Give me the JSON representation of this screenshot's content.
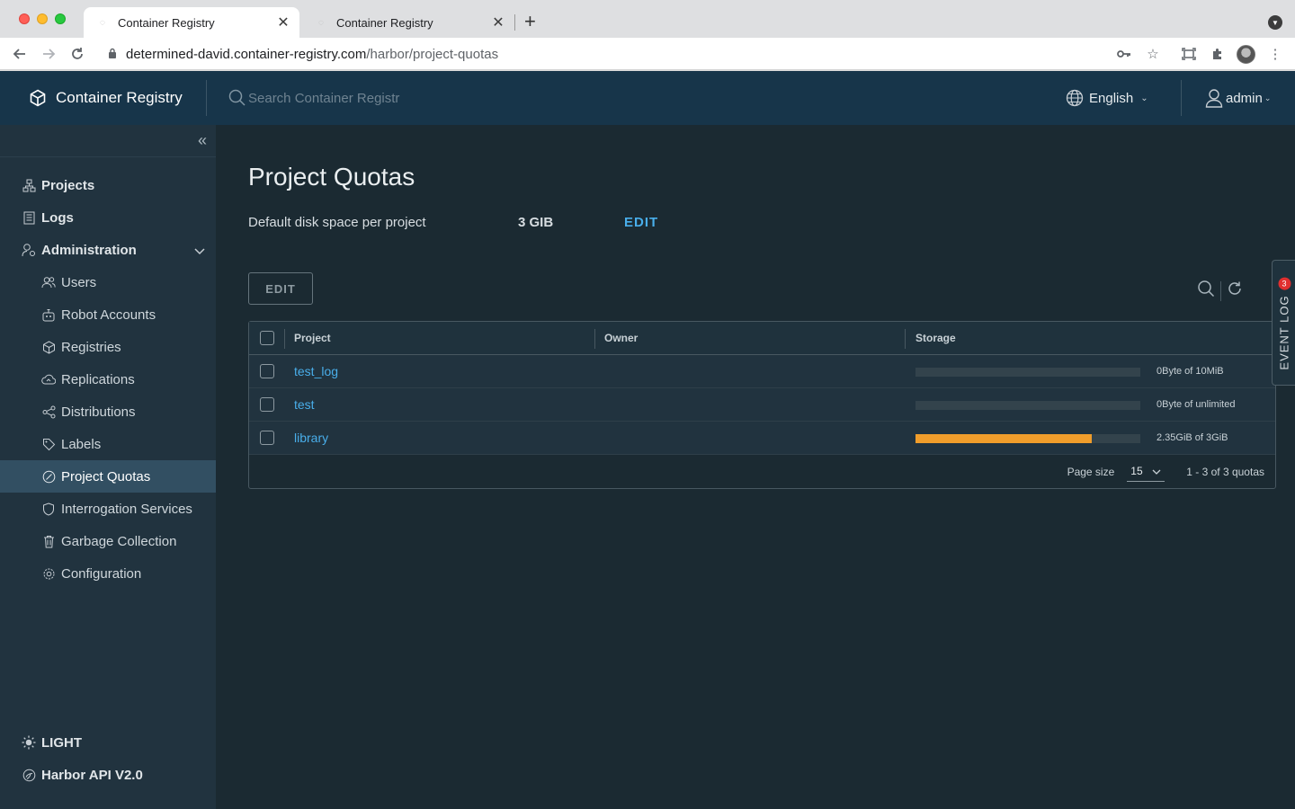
{
  "browser": {
    "tabs": [
      {
        "title": "Container Registry",
        "active": true
      },
      {
        "title": "Container Registry",
        "active": false
      }
    ],
    "url_host": "determined-david.container-registry.com",
    "url_path": "/harbor/project-quotas"
  },
  "header": {
    "brand": "Container Registry",
    "search_placeholder": "Search Container Registr",
    "language": "English",
    "user": "admin"
  },
  "sidebar": {
    "items": [
      {
        "label": "Projects"
      },
      {
        "label": "Logs"
      },
      {
        "label": "Administration"
      }
    ],
    "admin_items": [
      {
        "label": "Users"
      },
      {
        "label": "Robot Accounts"
      },
      {
        "label": "Registries"
      },
      {
        "label": "Replications"
      },
      {
        "label": "Distributions"
      },
      {
        "label": "Labels"
      },
      {
        "label": "Project Quotas",
        "active": true
      },
      {
        "label": "Interrogation Services"
      },
      {
        "label": "Garbage Collection"
      },
      {
        "label": "Configuration"
      }
    ],
    "bottom": {
      "theme": "LIGHT",
      "api": "Harbor API V2.0"
    }
  },
  "main": {
    "title": "Project Quotas",
    "default_label": "Default disk space per project",
    "default_value": "3 GIB",
    "default_edit": "EDIT",
    "edit_button": "EDIT",
    "columns": {
      "project": "Project",
      "owner": "Owner",
      "storage": "Storage"
    },
    "rows": [
      {
        "project": "test_log",
        "owner": "",
        "storage_text": "0Byte of 10MiB",
        "used_fraction": 0
      },
      {
        "project": "test",
        "owner": "",
        "storage_text": "0Byte of unlimited",
        "used_fraction": 0
      },
      {
        "project": "library",
        "owner": "",
        "storage_text": "2.35GiB of 3GiB",
        "used_fraction": 0.783
      }
    ],
    "footer": {
      "page_size_label": "Page size",
      "page_size_value": "15",
      "range_text": "1 - 3 of 3 quotas"
    }
  },
  "event_log": {
    "label": "EVENT LOG",
    "count": "3"
  },
  "colors": {
    "header_bg": "#17354a",
    "sidebar_bg": "#21333f",
    "main_bg": "#1b2a32",
    "link": "#49aeea",
    "bar_fill": "#f09d2b"
  }
}
